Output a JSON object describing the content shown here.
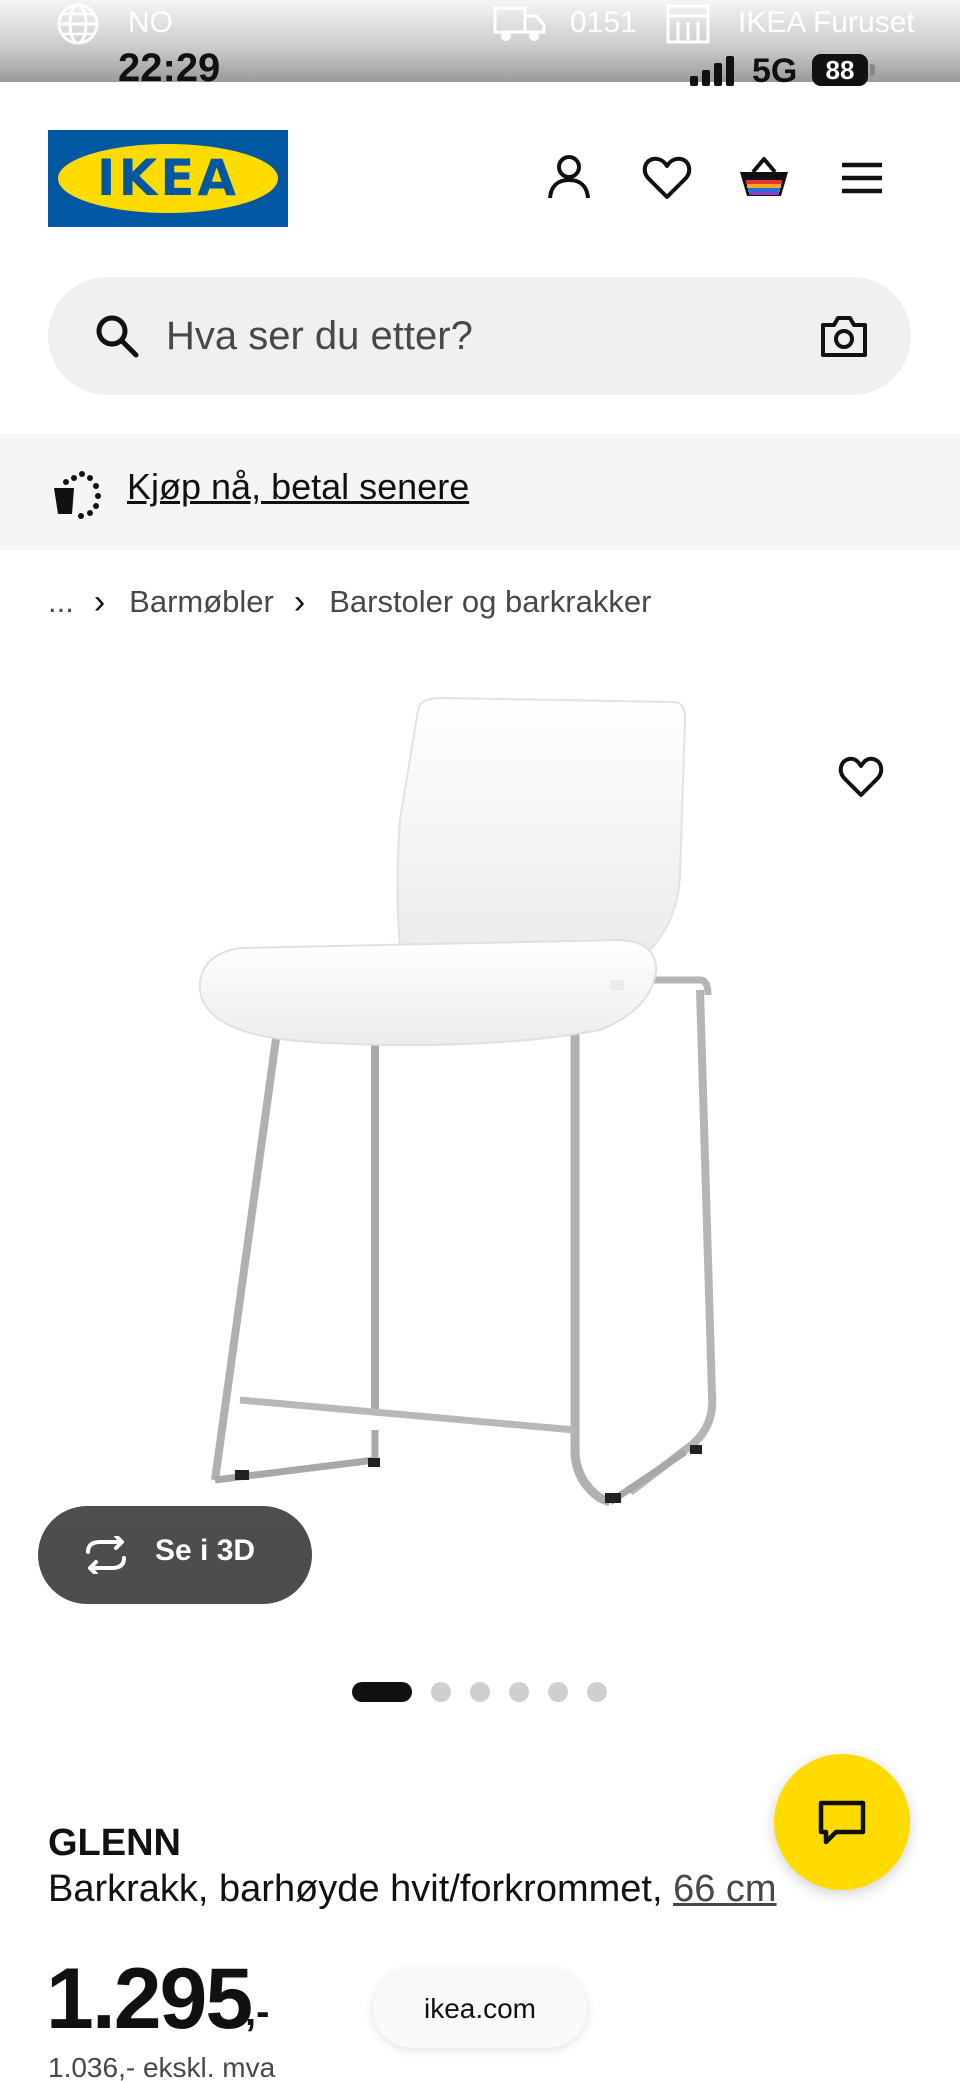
{
  "status_bar": {
    "region": "NO",
    "delivery_code": "0151",
    "store": "IKEA Furuset",
    "time": "22:29",
    "network": "5G",
    "battery": "88"
  },
  "header": {
    "logo_text": "IKEA",
    "icons": [
      "account-icon",
      "wishlist-icon",
      "shopping-bag-icon",
      "menu-icon"
    ]
  },
  "search": {
    "placeholder": "Hva ser du etter?"
  },
  "promo": {
    "link_text": "Kjøp nå, betal senere"
  },
  "breadcrumb": {
    "ellipsis": "...",
    "items": [
      "Barmøbler",
      "Barstoler og barkrakker"
    ]
  },
  "gallery": {
    "view_3d_label": "Se i 3D",
    "image_count": 6,
    "active_index": 0
  },
  "product": {
    "name": "GLENN",
    "description": "Barkrakk, barhøyde hvit/forkrommet, ",
    "size": "66 cm",
    "price": "1.295",
    "price_suffix": ",-",
    "price_ex_vat": "1.036,- ekskl. mva"
  },
  "floating": {
    "url": "ikea.com"
  },
  "colors": {
    "ikea_blue": "#0058a3",
    "ikea_yellow": "#ffdb00",
    "text_dark": "#111111",
    "text_grey": "#484848"
  }
}
